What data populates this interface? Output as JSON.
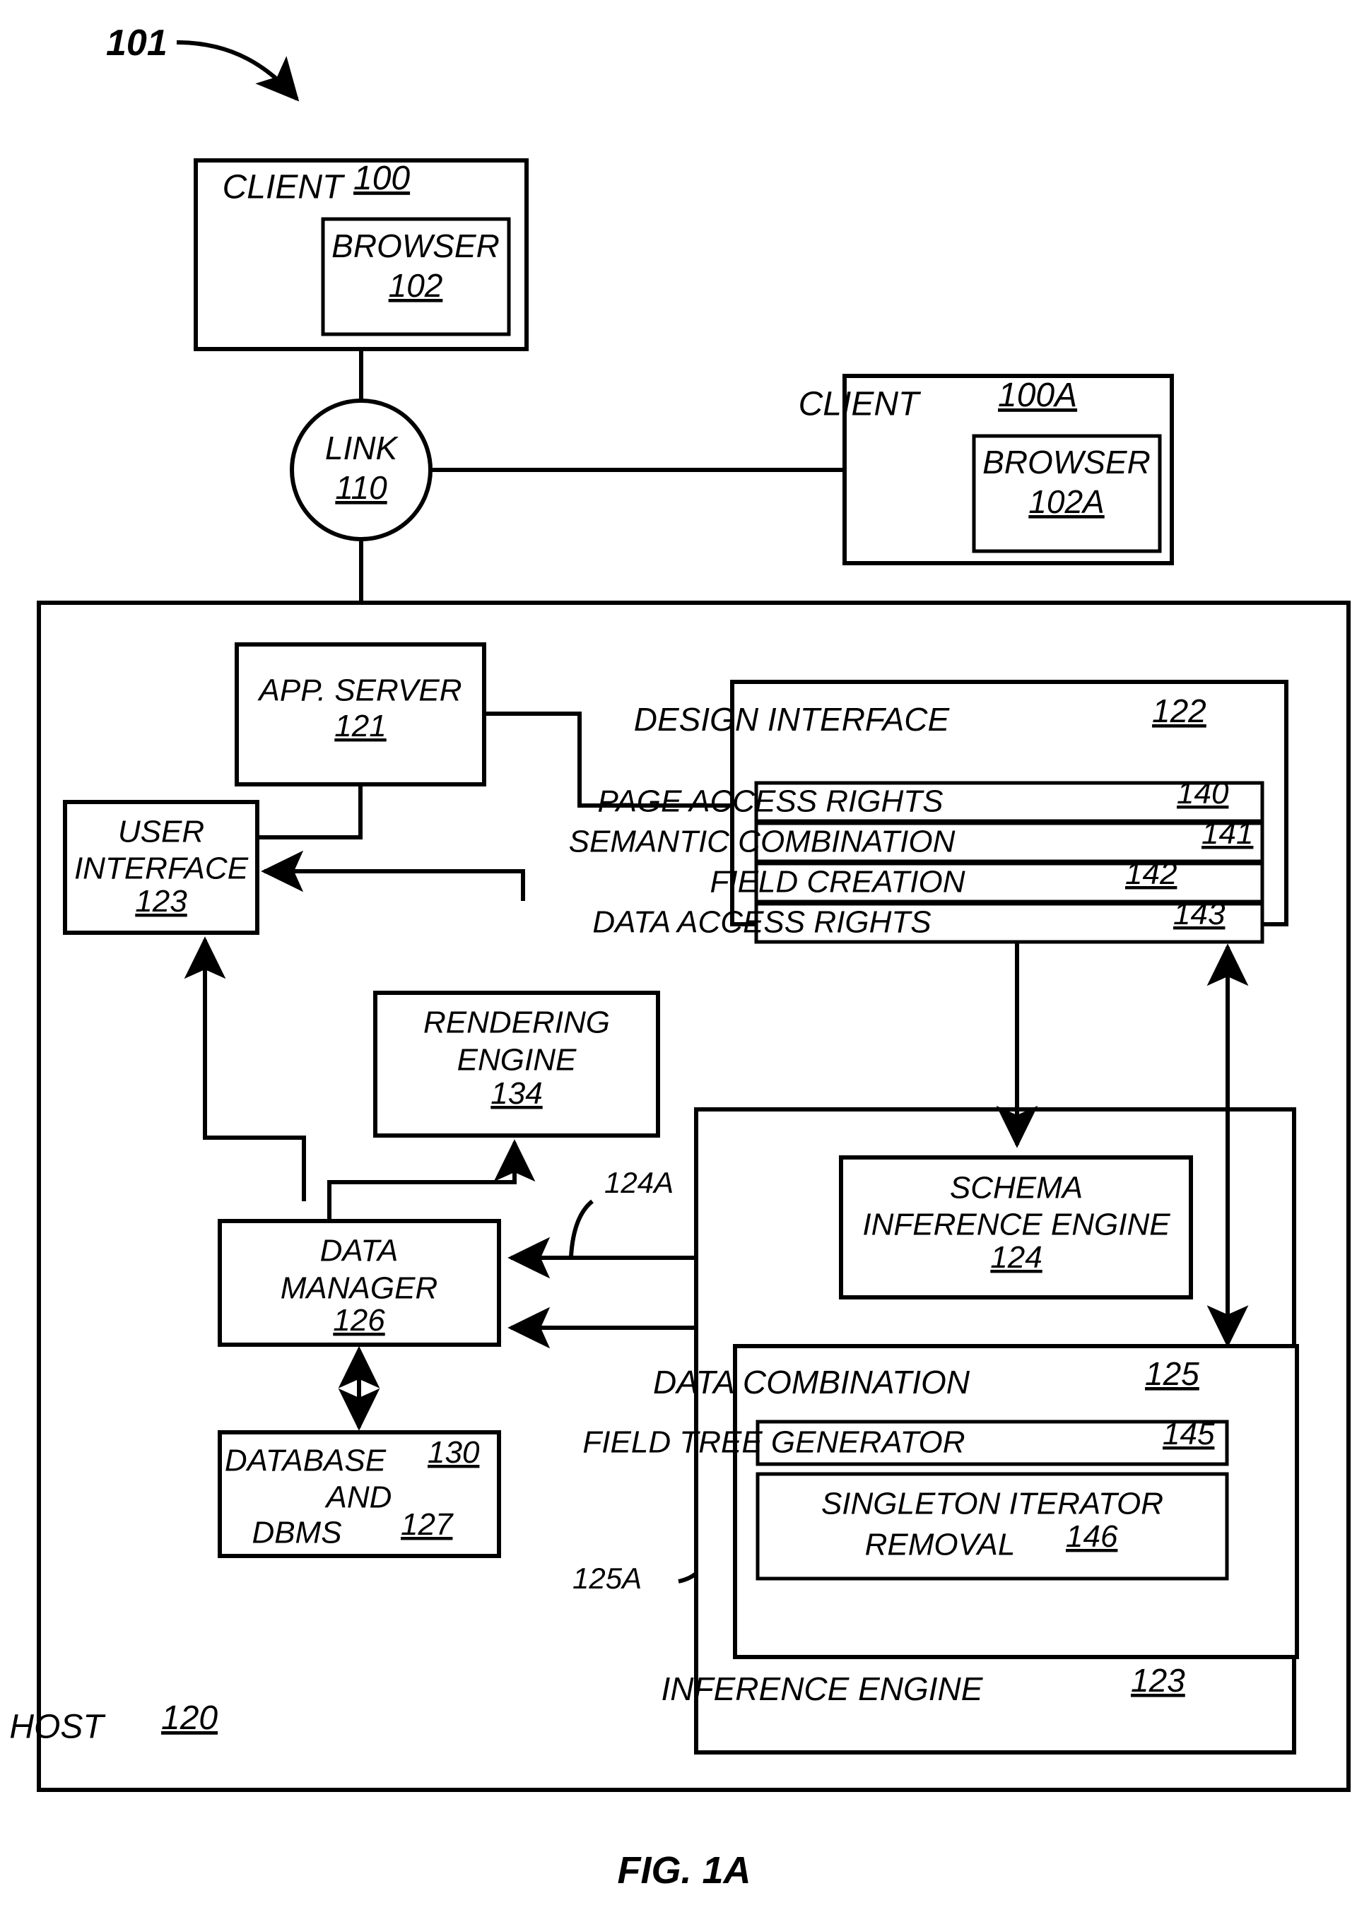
{
  "figure": {
    "caption": "FIG. 1A",
    "system_ref": "101"
  },
  "nodes": {
    "client": {
      "label": "CLIENT",
      "ref": "100"
    },
    "browser": {
      "label": "BROWSER",
      "ref": "102"
    },
    "client_a": {
      "label": "CLIENT",
      "ref": "100A"
    },
    "browser_a": {
      "label": "BROWSER",
      "ref": "102A"
    },
    "link": {
      "label": "LINK",
      "ref": "110"
    },
    "host": {
      "label": "HOST",
      "ref": "120"
    },
    "app_server": {
      "label": "APP. SERVER",
      "ref": "121"
    },
    "design_interface": {
      "label": "DESIGN INTERFACE",
      "ref": "122"
    },
    "page_access_rights": {
      "label": "PAGE ACCESS RIGHTS",
      "ref": "140"
    },
    "semantic_combination": {
      "label": "SEMANTIC COMBINATION",
      "ref": "141"
    },
    "field_creation": {
      "label": "FIELD CREATION",
      "ref": "142"
    },
    "data_access_rights": {
      "label": "DATA ACCESS RIGHTS",
      "ref": "143"
    },
    "user_interface": {
      "label_line1": "USER",
      "label_line2": "INTERFACE",
      "ref": "123"
    },
    "rendering_engine": {
      "label_line1": "RENDERING",
      "label_line2": "ENGINE",
      "ref": "134"
    },
    "data_manager": {
      "label_line1": "DATA",
      "label_line2": "MANAGER",
      "ref": "126"
    },
    "database": {
      "label_line1": "DATABASE",
      "ref1": "130",
      "label_line2": "AND",
      "label_line3": "DBMS",
      "ref3": "127"
    },
    "schema_inference_engine": {
      "label_line1": "SCHEMA",
      "label_line2": "INFERENCE ENGINE",
      "ref": "124"
    },
    "inference_engine": {
      "label": "INFERENCE ENGINE",
      "ref": "123"
    },
    "data_combination": {
      "label": "DATA COMBINATION",
      "ref": "125"
    },
    "field_tree_generator": {
      "label": "FIELD TREE GENERATOR",
      "ref": "145"
    },
    "singleton_iterator_removal": {
      "label_line1": "SINGLETON ITERATOR",
      "label_line2": "REMOVAL",
      "ref": "146"
    }
  },
  "connector_labels": {
    "schema_feed": "124A",
    "data_combination_feed": "125A"
  },
  "colors": {
    "line": "#000000",
    "fill": "#ffffff",
    "text": "#000000"
  }
}
